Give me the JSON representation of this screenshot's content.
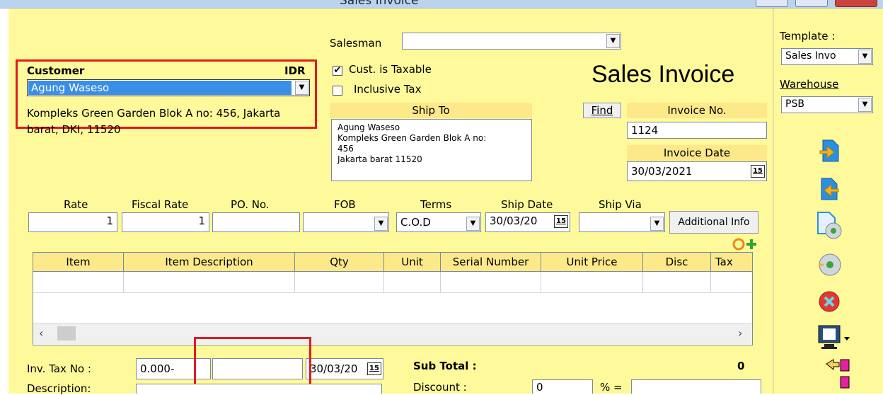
{
  "window": {
    "title": "Sales Invoice"
  },
  "form": {
    "heading": "Sales Invoice",
    "salesman_label": "Salesman",
    "salesman_value": "",
    "customer_label": "Customer",
    "currency": "IDR",
    "customer_value": "Agung Waseso",
    "customer_address_line1": "Kompleks Green Garden Blok A no: 456, Jakarta",
    "customer_address_line2": "barat, DKI, 11520",
    "cust_taxable_label": "Cust. is Taxable",
    "cust_taxable_checked": true,
    "inclusive_tax_label": "Inclusive Tax",
    "inclusive_tax_checked": false,
    "ship_to_label": "Ship To",
    "find_label": "Find",
    "ship_to_lines": [
      "Agung Waseso",
      "Kompleks Green Garden Blok A no:",
      "456",
      "Jakarta barat 11520"
    ],
    "invoice_no_label": "Invoice No.",
    "invoice_no": "1124",
    "invoice_date_label": "Invoice Date",
    "invoice_date": "30/03/2021",
    "rate_label": "Rate",
    "rate": "1",
    "fiscal_rate_label": "Fiscal Rate",
    "fiscal_rate": "1",
    "po_no_label": "PO. No.",
    "po_no": "",
    "fob_label": "FOB",
    "fob": "",
    "terms_label": "Terms",
    "terms": "C.O.D",
    "ship_date_label": "Ship Date",
    "ship_date": "30/03/20",
    "ship_via_label": "Ship Via",
    "ship_via": "",
    "additional_info_label": "Additional Info",
    "cal_glyph": "15"
  },
  "grid": {
    "columns": [
      "Item",
      "Item Description",
      "Qty",
      "Unit",
      "Serial Number",
      "Unit Price",
      "Disc",
      "Tax"
    ]
  },
  "footer": {
    "inv_tax_no_label": "Inv. Tax No :",
    "inv_tax_no_prefix": "0.000-",
    "inv_tax_no_mid": "",
    "inv_tax_date": "30/03/20",
    "description_label": "Description:",
    "subtotal_label": "Sub Total :",
    "subtotal_value": "0",
    "discount_label": "Discount :",
    "discount_pct": "0",
    "pct_eq": "% ="
  },
  "right_panel": {
    "template_label": "Template :",
    "template_value": "Sales Invo",
    "warehouse_label": "Warehouse",
    "warehouse_value": "PSB"
  },
  "colors": {
    "form_bg": "#fef99a",
    "header_band": "#fde98a",
    "selection": "#3a8ee6",
    "highlight": "#e11b22"
  }
}
